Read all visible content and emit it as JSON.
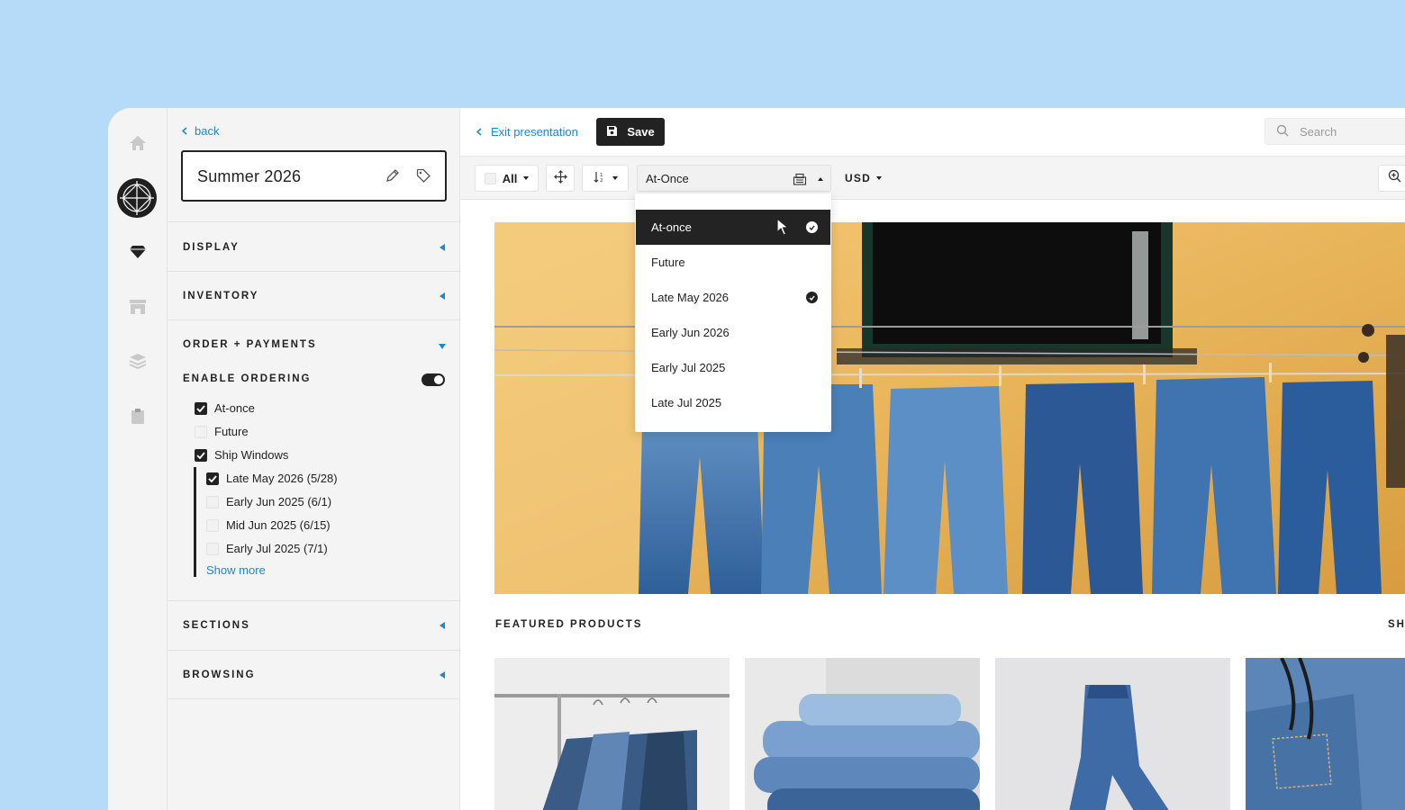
{
  "colors": {
    "background": "#b6dbf9",
    "accent": "#1d86d6",
    "dark": "#222222"
  },
  "rail": {
    "icons": [
      "home-icon",
      "brand-logo",
      "diamond-icon",
      "store-icon",
      "layers-icon",
      "clipboard-icon"
    ]
  },
  "sidebar": {
    "back_label": "back",
    "collection_name": "Summer 2026",
    "sections": {
      "display": "DISPLAY",
      "inventory": "INVENTORY",
      "order_payments": "ORDER + PAYMENTS",
      "enable_ordering": "ENABLE ORDERING",
      "sections": "SECTIONS",
      "browsing": "BROWSING"
    },
    "enable_ordering_on": true,
    "options": [
      {
        "label": "At-once",
        "checked": true
      },
      {
        "label": "Future",
        "checked": false
      },
      {
        "label": "Ship Windows",
        "checked": true
      }
    ],
    "ship_windows": [
      {
        "label": "Late May 2026 (5/28)",
        "checked": true
      },
      {
        "label": "Early Jun 2025 (6/1)",
        "checked": false
      },
      {
        "label": "Mid Jun 2025 (6/15)",
        "checked": false
      },
      {
        "label": "Early Jul 2025 (7/1)",
        "checked": false
      }
    ],
    "show_more": "Show more"
  },
  "header": {
    "exit_label": "Exit presentation",
    "save_label": "Save",
    "search_placeholder": "Search"
  },
  "toolbar": {
    "all_label": "All",
    "ship_select_value": "At-Once",
    "currency": "USD"
  },
  "dropdown": {
    "items": [
      {
        "label": "At-once",
        "checked": true,
        "active": true
      },
      {
        "label": "Future",
        "checked": false,
        "active": false
      },
      {
        "label": "Late May 2026",
        "checked": true,
        "active": false
      },
      {
        "label": "Early Jun 2026",
        "checked": false,
        "active": false
      },
      {
        "label": "Early Jul 2025",
        "checked": false,
        "active": false
      },
      {
        "label": "Late Jul 2025",
        "checked": false,
        "active": false
      }
    ]
  },
  "content": {
    "featured_title": "FEATURED PRODUCTS",
    "side_label": "SH"
  }
}
